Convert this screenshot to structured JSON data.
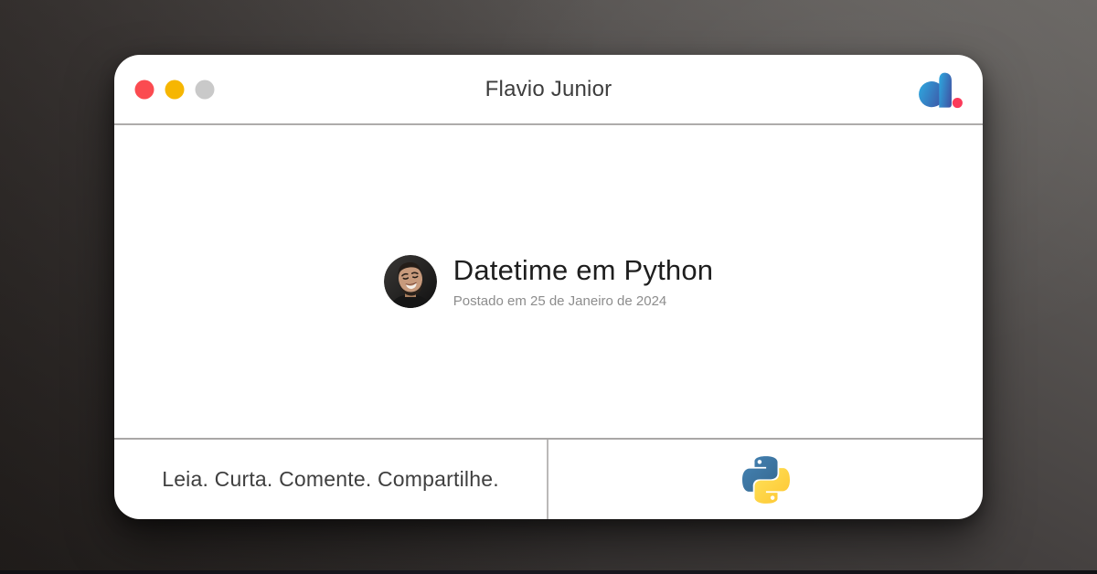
{
  "window": {
    "title": "Flavio Junior",
    "controls": {
      "close_color": "#fb4b50",
      "minimize_color": "#f6b602",
      "maximize_color": "#c9c9c9"
    },
    "brand": {
      "name": "dio-logo",
      "blue_start": "#2fa2db",
      "blue_end": "#3e56a6",
      "dot_color": "#fb3a5a"
    }
  },
  "post": {
    "title": "Datetime em Python",
    "date": "Postado em 25 de Janeiro de 2024"
  },
  "footer": {
    "tagline": "Leia. Curta. Comente. Compartilhe.",
    "python": {
      "name": "python-logo",
      "blue_start": "#4584b5",
      "blue_end": "#35678f",
      "yellow_start": "#ffe35a",
      "yellow_end": "#fdc531"
    }
  }
}
